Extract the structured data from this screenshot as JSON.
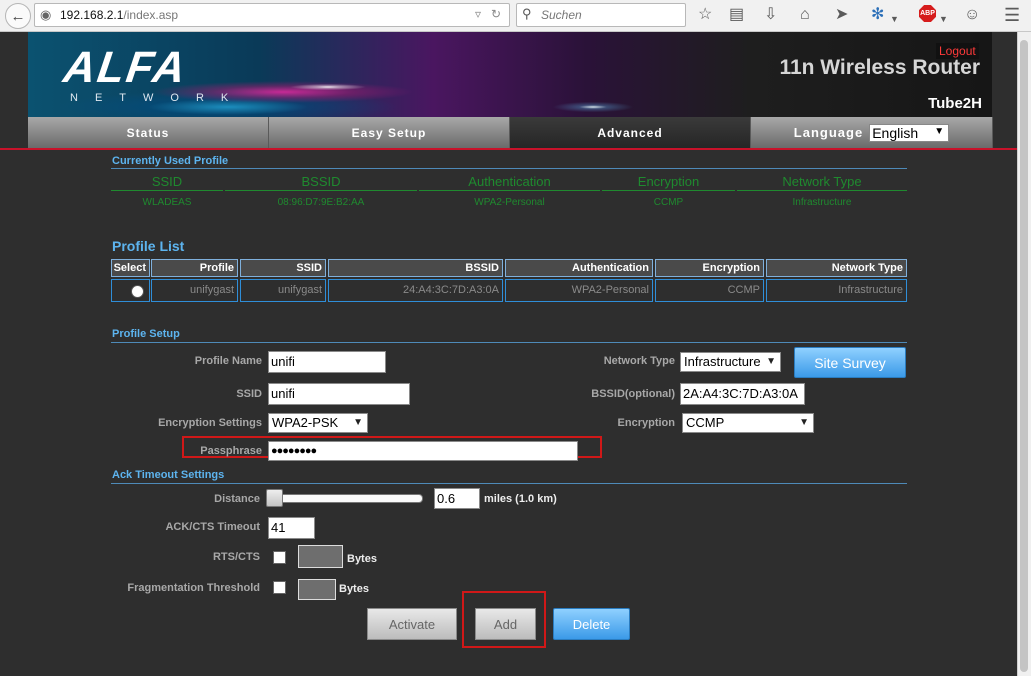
{
  "browser": {
    "url_host": "192.168.2.1",
    "url_path": "/index.asp",
    "search_placeholder": "Suchen",
    "abp_label": "ABP"
  },
  "header": {
    "logo_main": "ALFA",
    "logo_sub": "NETWORK",
    "logout": "Logout",
    "title": "11n Wireless Router",
    "model": "Tube2H"
  },
  "nav": {
    "tabs": [
      "Status",
      "Easy Setup",
      "Advanced"
    ],
    "active_tab": "Advanced",
    "language_label": "Language",
    "language_value": "English"
  },
  "current_profile": {
    "title": "Currently Used Profile",
    "headers": [
      "SSID",
      "BSSID",
      "Authentication",
      "Encryption",
      "Network Type"
    ],
    "values": [
      "WLADEAS",
      "08:96:D7:9E:B2:AA",
      "WPA2-Personal",
      "CCMP",
      "Infrastructure"
    ]
  },
  "profile_list": {
    "title": "Profile List",
    "headers": [
      "Select",
      "Profile",
      "SSID",
      "BSSID",
      "Authentication",
      "Encryption",
      "Network Type"
    ],
    "rows": [
      [
        "",
        "unifygast",
        "unifygast",
        "24:A4:3C:7D:A3:0A",
        "WPA2-Personal",
        "CCMP",
        "Infrastructure"
      ]
    ]
  },
  "profile_setup": {
    "title": "Profile Setup",
    "profile_name_label": "Profile Name",
    "profile_name_value": "unifi",
    "ssid_label": "SSID",
    "ssid_value": "unifi",
    "encryption_settings_label": "Encryption Settings",
    "encryption_settings_value": "WPA2-PSK",
    "passphrase_label": "Passphrase",
    "passphrase_value": "●●●●●●●●",
    "network_type_label": "Network Type",
    "network_type_value": "Infrastructure",
    "site_survey": "Site Survey",
    "bssid_label": "BSSID(optional)",
    "bssid_value": "2A:A4:3C:7D:A3:0A",
    "encryption_label": "Encryption",
    "encryption_value": "CCMP"
  },
  "ack": {
    "title": "Ack Timeout Settings",
    "distance_label": "Distance",
    "distance_value": "0.6",
    "distance_unit": "miles (1.0 km)",
    "ackcts_label": "ACK/CTS Timeout",
    "ackcts_value": "41",
    "rtscts_label": "RTS/CTS",
    "rtscts_unit": "Bytes",
    "frag_label": "Fragmentation Threshold",
    "frag_unit": "Bytes"
  },
  "buttons": {
    "activate": "Activate",
    "add": "Add",
    "delete": "Delete"
  },
  "colors": {
    "accent_red": "#c8122a",
    "section_blue": "#5db4ef",
    "profile_green": "#1f8a2f"
  }
}
